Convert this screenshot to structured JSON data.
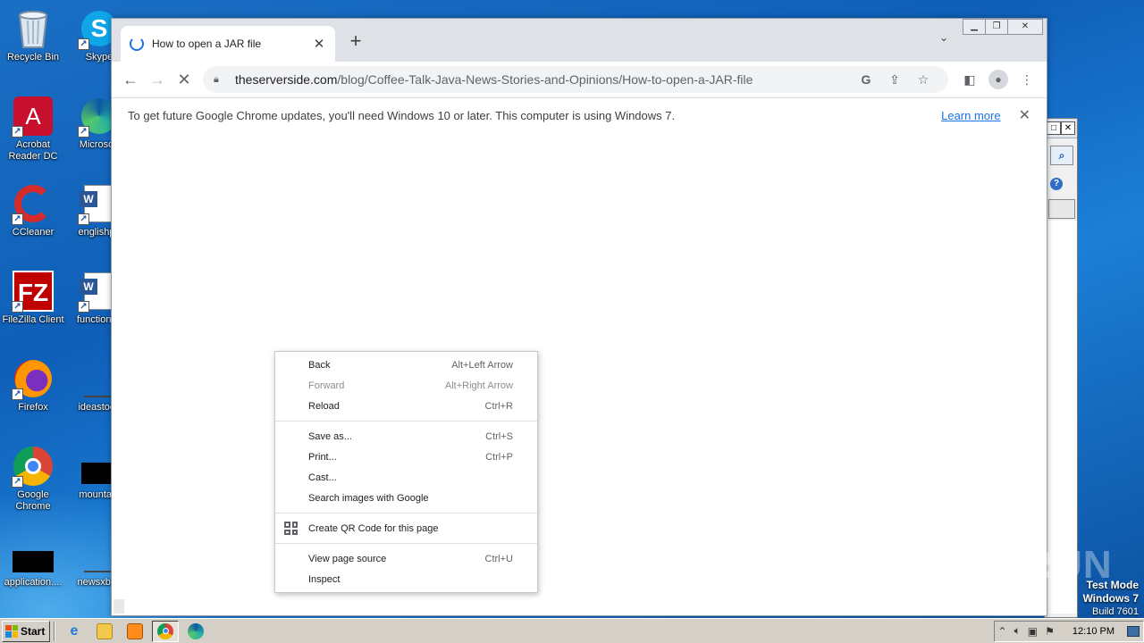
{
  "desktop": {
    "icons": [
      {
        "label": "Recycle Bin",
        "icon": "recycle-bin-icon"
      },
      {
        "label": "Skype",
        "icon": "skype-icon"
      },
      {
        "label": "Acrobat Reader DC",
        "icon": "acrobat-icon"
      },
      {
        "label": "Microsoft",
        "icon": "edge-icon"
      },
      {
        "label": "CCleaner",
        "icon": "ccleaner-icon"
      },
      {
        "label": "englishpri",
        "icon": "word-doc-icon"
      },
      {
        "label": "FileZilla Client",
        "icon": "filezilla-icon"
      },
      {
        "label": "functionsp",
        "icon": "word-doc-icon"
      },
      {
        "label": "Firefox",
        "icon": "firefox-icon"
      },
      {
        "label": "ideastook",
        "icon": "file-icon"
      },
      {
        "label": "Google Chrome",
        "icon": "chrome-icon"
      },
      {
        "label": "mountain",
        "icon": "file-icon"
      },
      {
        "label": "application....",
        "icon": "file-icon"
      },
      {
        "label": "newsxbox",
        "icon": "file-icon"
      }
    ]
  },
  "browser": {
    "tab_title": "How to open a JAR file",
    "tab_close": "✕",
    "new_tab": "+",
    "url_host": "theserverside.com",
    "url_path": "/blog/Coffee-Talk-Java-News-Stories-and-Opinions/How-to-open-a-JAR-file",
    "infobar_message": "To get future Google Chrome updates, you'll need Windows 10 or later. This computer is using Windows 7.",
    "infobar_link": "Learn more"
  },
  "context_menu": {
    "groups": [
      [
        {
          "label": "Back",
          "shortcut": "Alt+Left Arrow",
          "disabled": false
        },
        {
          "label": "Forward",
          "shortcut": "Alt+Right Arrow",
          "disabled": true
        },
        {
          "label": "Reload",
          "shortcut": "Ctrl+R",
          "disabled": false
        }
      ],
      [
        {
          "label": "Save as...",
          "shortcut": "Ctrl+S",
          "disabled": false
        },
        {
          "label": "Print...",
          "shortcut": "Ctrl+P",
          "disabled": false
        },
        {
          "label": "Cast...",
          "shortcut": "",
          "disabled": false
        },
        {
          "label": "Search images with Google",
          "shortcut": "",
          "disabled": false
        }
      ],
      [
        {
          "label": "Create QR Code for this page",
          "shortcut": "",
          "disabled": false,
          "icon": "qr-code-icon"
        }
      ],
      [
        {
          "label": "View page source",
          "shortcut": "Ctrl+U",
          "disabled": false
        },
        {
          "label": "Inspect",
          "shortcut": "",
          "disabled": false
        }
      ]
    ]
  },
  "watermark": "ANY RUN",
  "os_info": {
    "line1": "Test Mode",
    "line2": "Windows 7",
    "line3": "Build 7601"
  },
  "taskbar": {
    "start_label": "Start",
    "clock": "12:10 PM",
    "apps": [
      "ie-icon",
      "explorer-icon",
      "media-player-icon",
      "chrome-icon",
      "edge-icon"
    ]
  },
  "colors": {
    "desktop_bg": "#1a6fc4",
    "accent": "#1a73e8",
    "tabstrip": "#dee1e6",
    "taskbar": "#d4d0c8"
  }
}
